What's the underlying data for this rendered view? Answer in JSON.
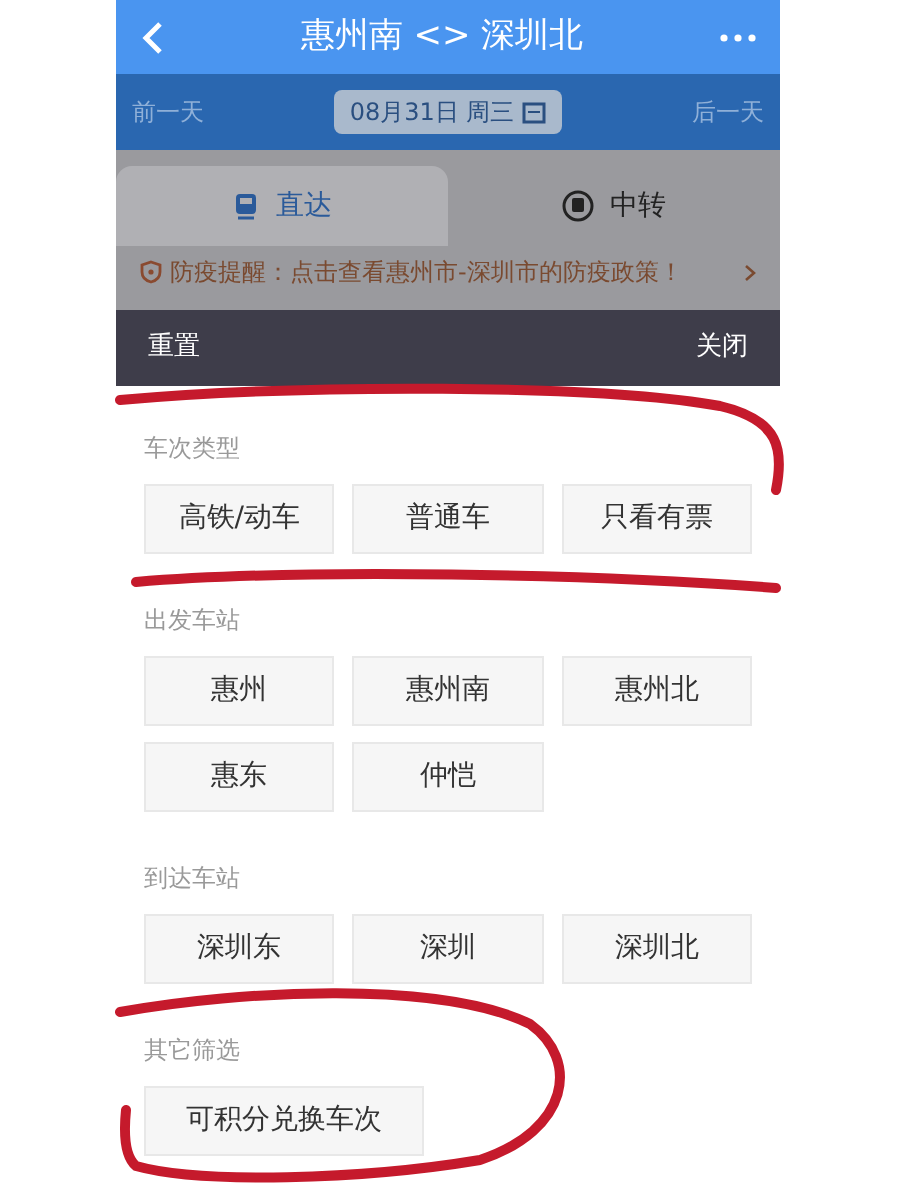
{
  "header": {
    "title": "惠州南 <> 深圳北"
  },
  "date_bar": {
    "prev": "前一天",
    "date": "08月31日 周三",
    "next": "后一天"
  },
  "tabs": [
    {
      "label": "直达",
      "selected": true
    },
    {
      "label": "中转",
      "selected": false
    }
  ],
  "notice": "防疫提醒：点击查看惠州市-深圳市的防疫政策！",
  "filter_bar": {
    "reset": "重置",
    "close": "关闭"
  },
  "sections": [
    {
      "title": "车次类型",
      "options": [
        "高铁/动车",
        "普通车",
        "只看有票"
      ]
    },
    {
      "title": "出发车站",
      "options": [
        "惠州",
        "惠州南",
        "惠州北",
        "惠东",
        "仲恺"
      ]
    },
    {
      "title": "到达车站",
      "options": [
        "深圳东",
        "深圳",
        "深圳北"
      ]
    },
    {
      "title": "其它筛选",
      "options": [
        "可积分兑换车次"
      ]
    }
  ]
}
